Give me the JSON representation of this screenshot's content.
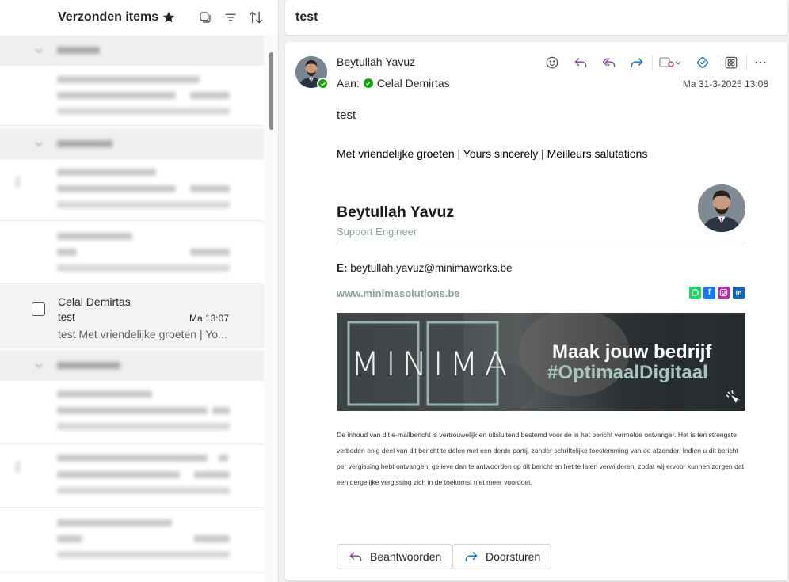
{
  "list": {
    "title": "Verzonden items",
    "selected_item": {
      "sender": "Celal Demirtas",
      "subject": "test",
      "time": "Ma 13:07",
      "preview": "test Met vriendelijke groeten | Yo..."
    }
  },
  "reading": {
    "subject": "test",
    "from_name": "Beytullah Yavuz",
    "to_label": "Aan:",
    "to_name": "Celal Demirtas",
    "date": "Ma 31-3-2025 13:08",
    "body": "test",
    "regards": "Met vriendelijke groeten | Yours sincerely | Meilleurs salutations",
    "signature": {
      "name": "Beytullah Yavuz",
      "role": "Support Engineer",
      "email_label": "E:",
      "email": "beytullah.yavuz@minimaworks.be",
      "website": "www.minimasolutions.be",
      "banner_logo": "MINIMA",
      "banner_line1": "Maak jouw bedrijf",
      "banner_line2": "#OptimaalDigitaal"
    },
    "disclaimer": "De inhoud van dit e-mailbericht is vertrouwelijk en uitsluitend bestemd voor de in het bericht vermelde ontvanger. Het is ten strengste verboden enig deel van dit bericht te delen met een derde partij, zonder schriftelijke toestemming van de afzender. Indien u dit bericht per vergissing hebt ontvangen, gelieve dan te antwoorden op dit bericht en het te laten verwijderen, zodat wij ervoor kunnen zorgen dat een dergelijke vergissing zich in de toekomst niet meer voordoet.",
    "reply_label": "Beantwoorden",
    "forward_label": "Doorsturen"
  },
  "colors": {
    "accent_purple": "#8a3f9e",
    "accent_blue": "#0f6cbd",
    "signature_green": "#8aa59b",
    "presence_green": "#13a10e"
  },
  "icons": [
    "star-icon",
    "select-icon",
    "filter-icon",
    "sort-icon",
    "emoji-icon",
    "reply-icon",
    "reply-all-icon",
    "forward-icon",
    "tag-icon",
    "loop-icon",
    "apps-icon",
    "more-icon",
    "whatsapp-icon",
    "facebook-icon",
    "instagram-icon",
    "linkedin-icon"
  ]
}
